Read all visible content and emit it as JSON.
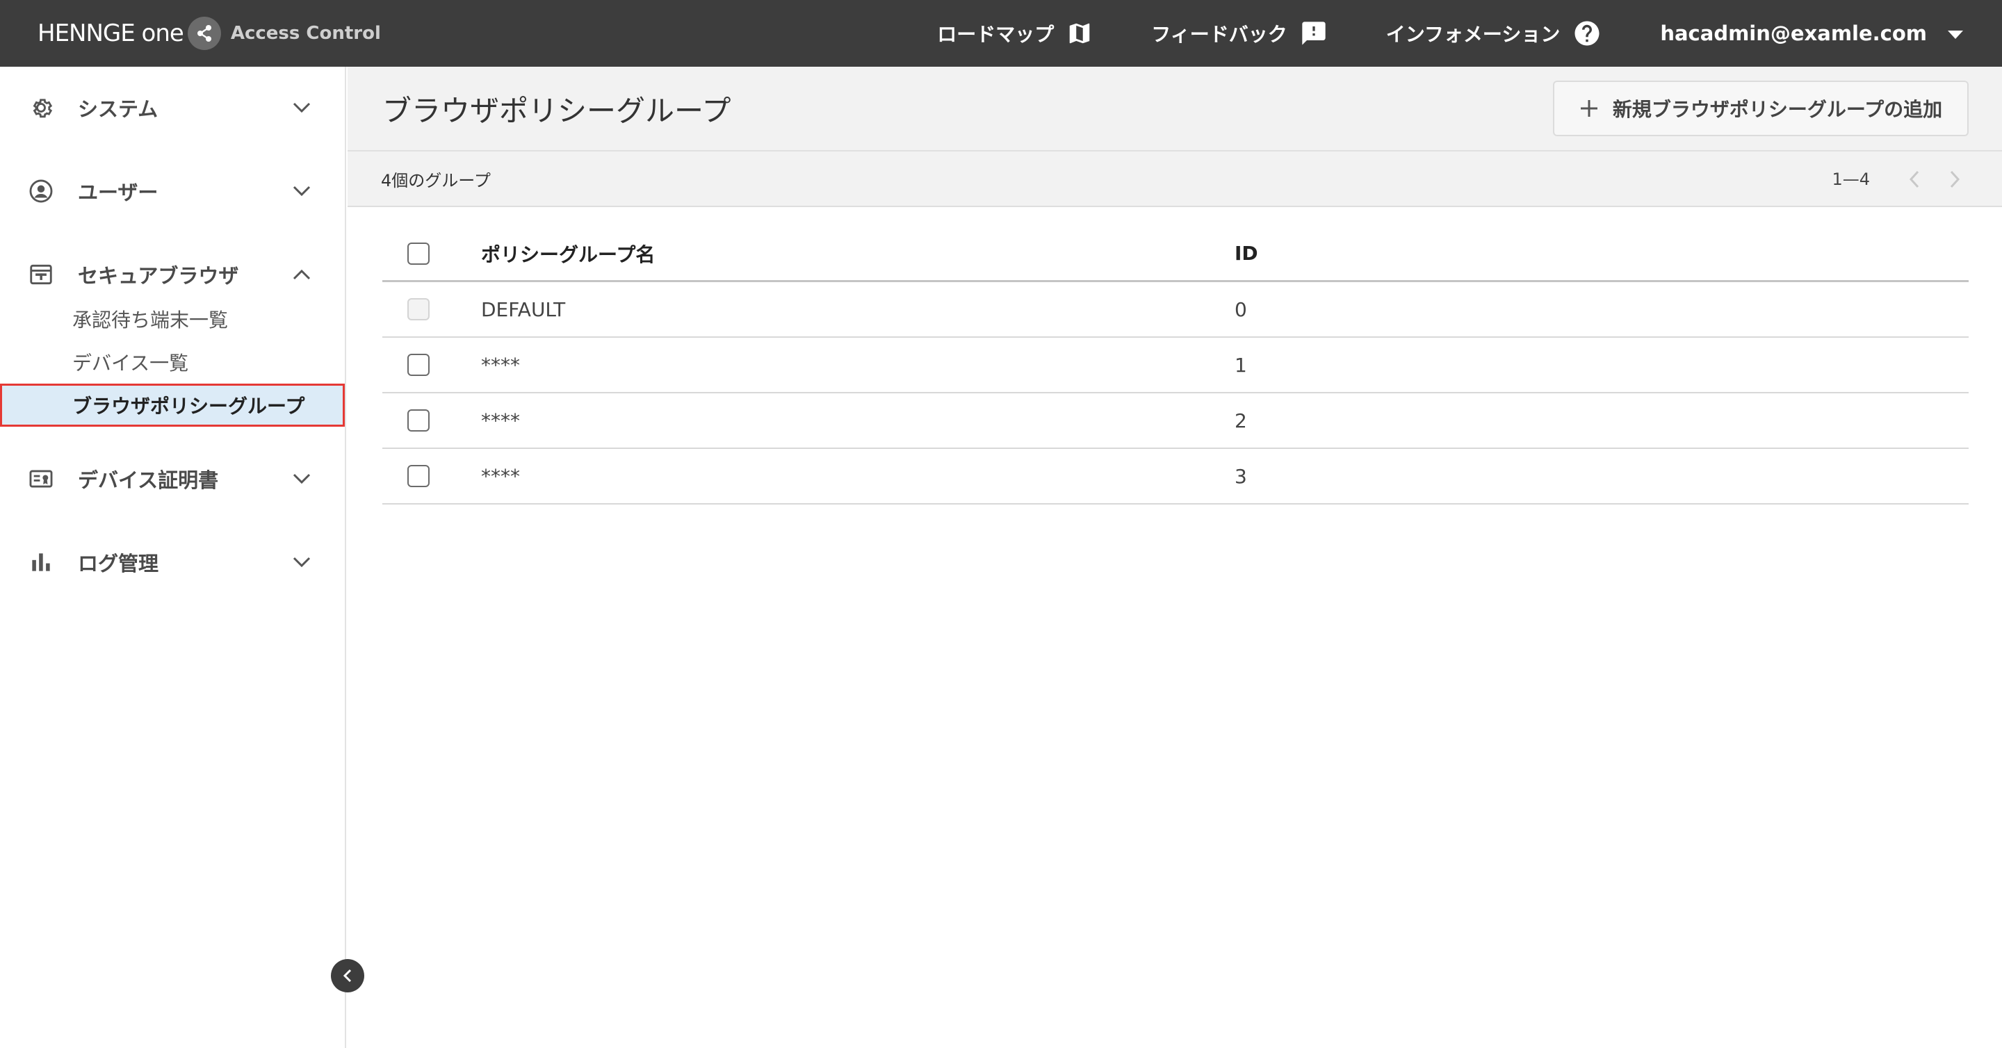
{
  "topbar": {
    "brand_name": "HENNGE one",
    "brand_product": "Access Control",
    "nav": [
      {
        "label": "ロードマップ",
        "icon": "map-icon"
      },
      {
        "label": "フィードバック",
        "icon": "feedback-icon"
      },
      {
        "label": "インフォメーション",
        "icon": "help-icon"
      }
    ],
    "user_email": "hacadmin@examle.com"
  },
  "sidebar": {
    "sections": [
      {
        "label": "システム",
        "icon": "gear-icon",
        "expanded": false
      },
      {
        "label": "ユーザー",
        "icon": "user-circle-icon",
        "expanded": false
      },
      {
        "label": "セキュアブラウザ",
        "icon": "browser-icon",
        "expanded": true,
        "items": [
          "承認待ち端末一覧",
          "デバイス一覧",
          "ブラウザポリシーグループ"
        ]
      },
      {
        "label": "デバイス証明書",
        "icon": "certificate-icon",
        "expanded": false
      },
      {
        "label": "ログ管理",
        "icon": "bar-chart-icon",
        "expanded": false
      }
    ]
  },
  "main": {
    "title": "ブラウザポリシーグループ",
    "add_button_label": "新規ブラウザポリシーグループの追加",
    "count_text": "4個のグループ",
    "pager_range": "1—4",
    "table": {
      "headers": [
        "ポリシーグループ名",
        "ID"
      ],
      "rows": [
        {
          "name": "DEFAULT",
          "id": "0",
          "disabled": true
        },
        {
          "name": "****",
          "id": "1",
          "disabled": false
        },
        {
          "name": "****",
          "id": "2",
          "disabled": false
        },
        {
          "name": "****",
          "id": "3",
          "disabled": false
        }
      ]
    }
  },
  "colors": {
    "topbar_bg": "#3d3d3d",
    "active_bg": "#dcebf7",
    "highlight_border": "#e53935"
  }
}
